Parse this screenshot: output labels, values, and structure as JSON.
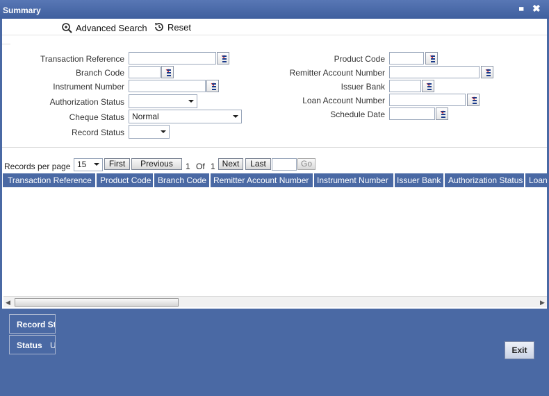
{
  "window": {
    "title": "Summary",
    "minimize": "▄",
    "close": "✖"
  },
  "toolbar": {
    "advanced_search": "Advanced Search",
    "reset": "Reset"
  },
  "fields": {
    "transaction_reference": "Transaction Reference",
    "branch_code": "Branch Code",
    "instrument_number": "Instrument Number",
    "authorization_status": "Authorization Status",
    "cheque_status": "Cheque Status",
    "record_status": "Record Status",
    "product_code": "Product Code",
    "remitter_account_number": "Remitter Account Number",
    "issuer_bank": "Issuer Bank",
    "loan_account_number": "Loan Account Number",
    "schedule_date": "Schedule Date"
  },
  "values": {
    "cheque_status": "Normal"
  },
  "pager": {
    "records_per_page_label": "Records per page",
    "records_per_page": "15",
    "first": "First",
    "previous": "Previous",
    "current_page": "1",
    "of": "Of",
    "total_pages": "1",
    "next": "Next",
    "last": "Last",
    "go": "Go"
  },
  "grid": {
    "columns": [
      "Transaction Reference",
      "Product Code",
      "Branch Code",
      "Remitter Account Number",
      "Instrument Number",
      "Issuer Bank",
      "Authorization Status",
      "Loan"
    ]
  },
  "footer": {
    "record_status": "Record St",
    "status_label": "Status",
    "status_value": "U",
    "exit": "Exit"
  },
  "colors": {
    "accent": "#4a69a4",
    "header": "#4a69a4"
  }
}
